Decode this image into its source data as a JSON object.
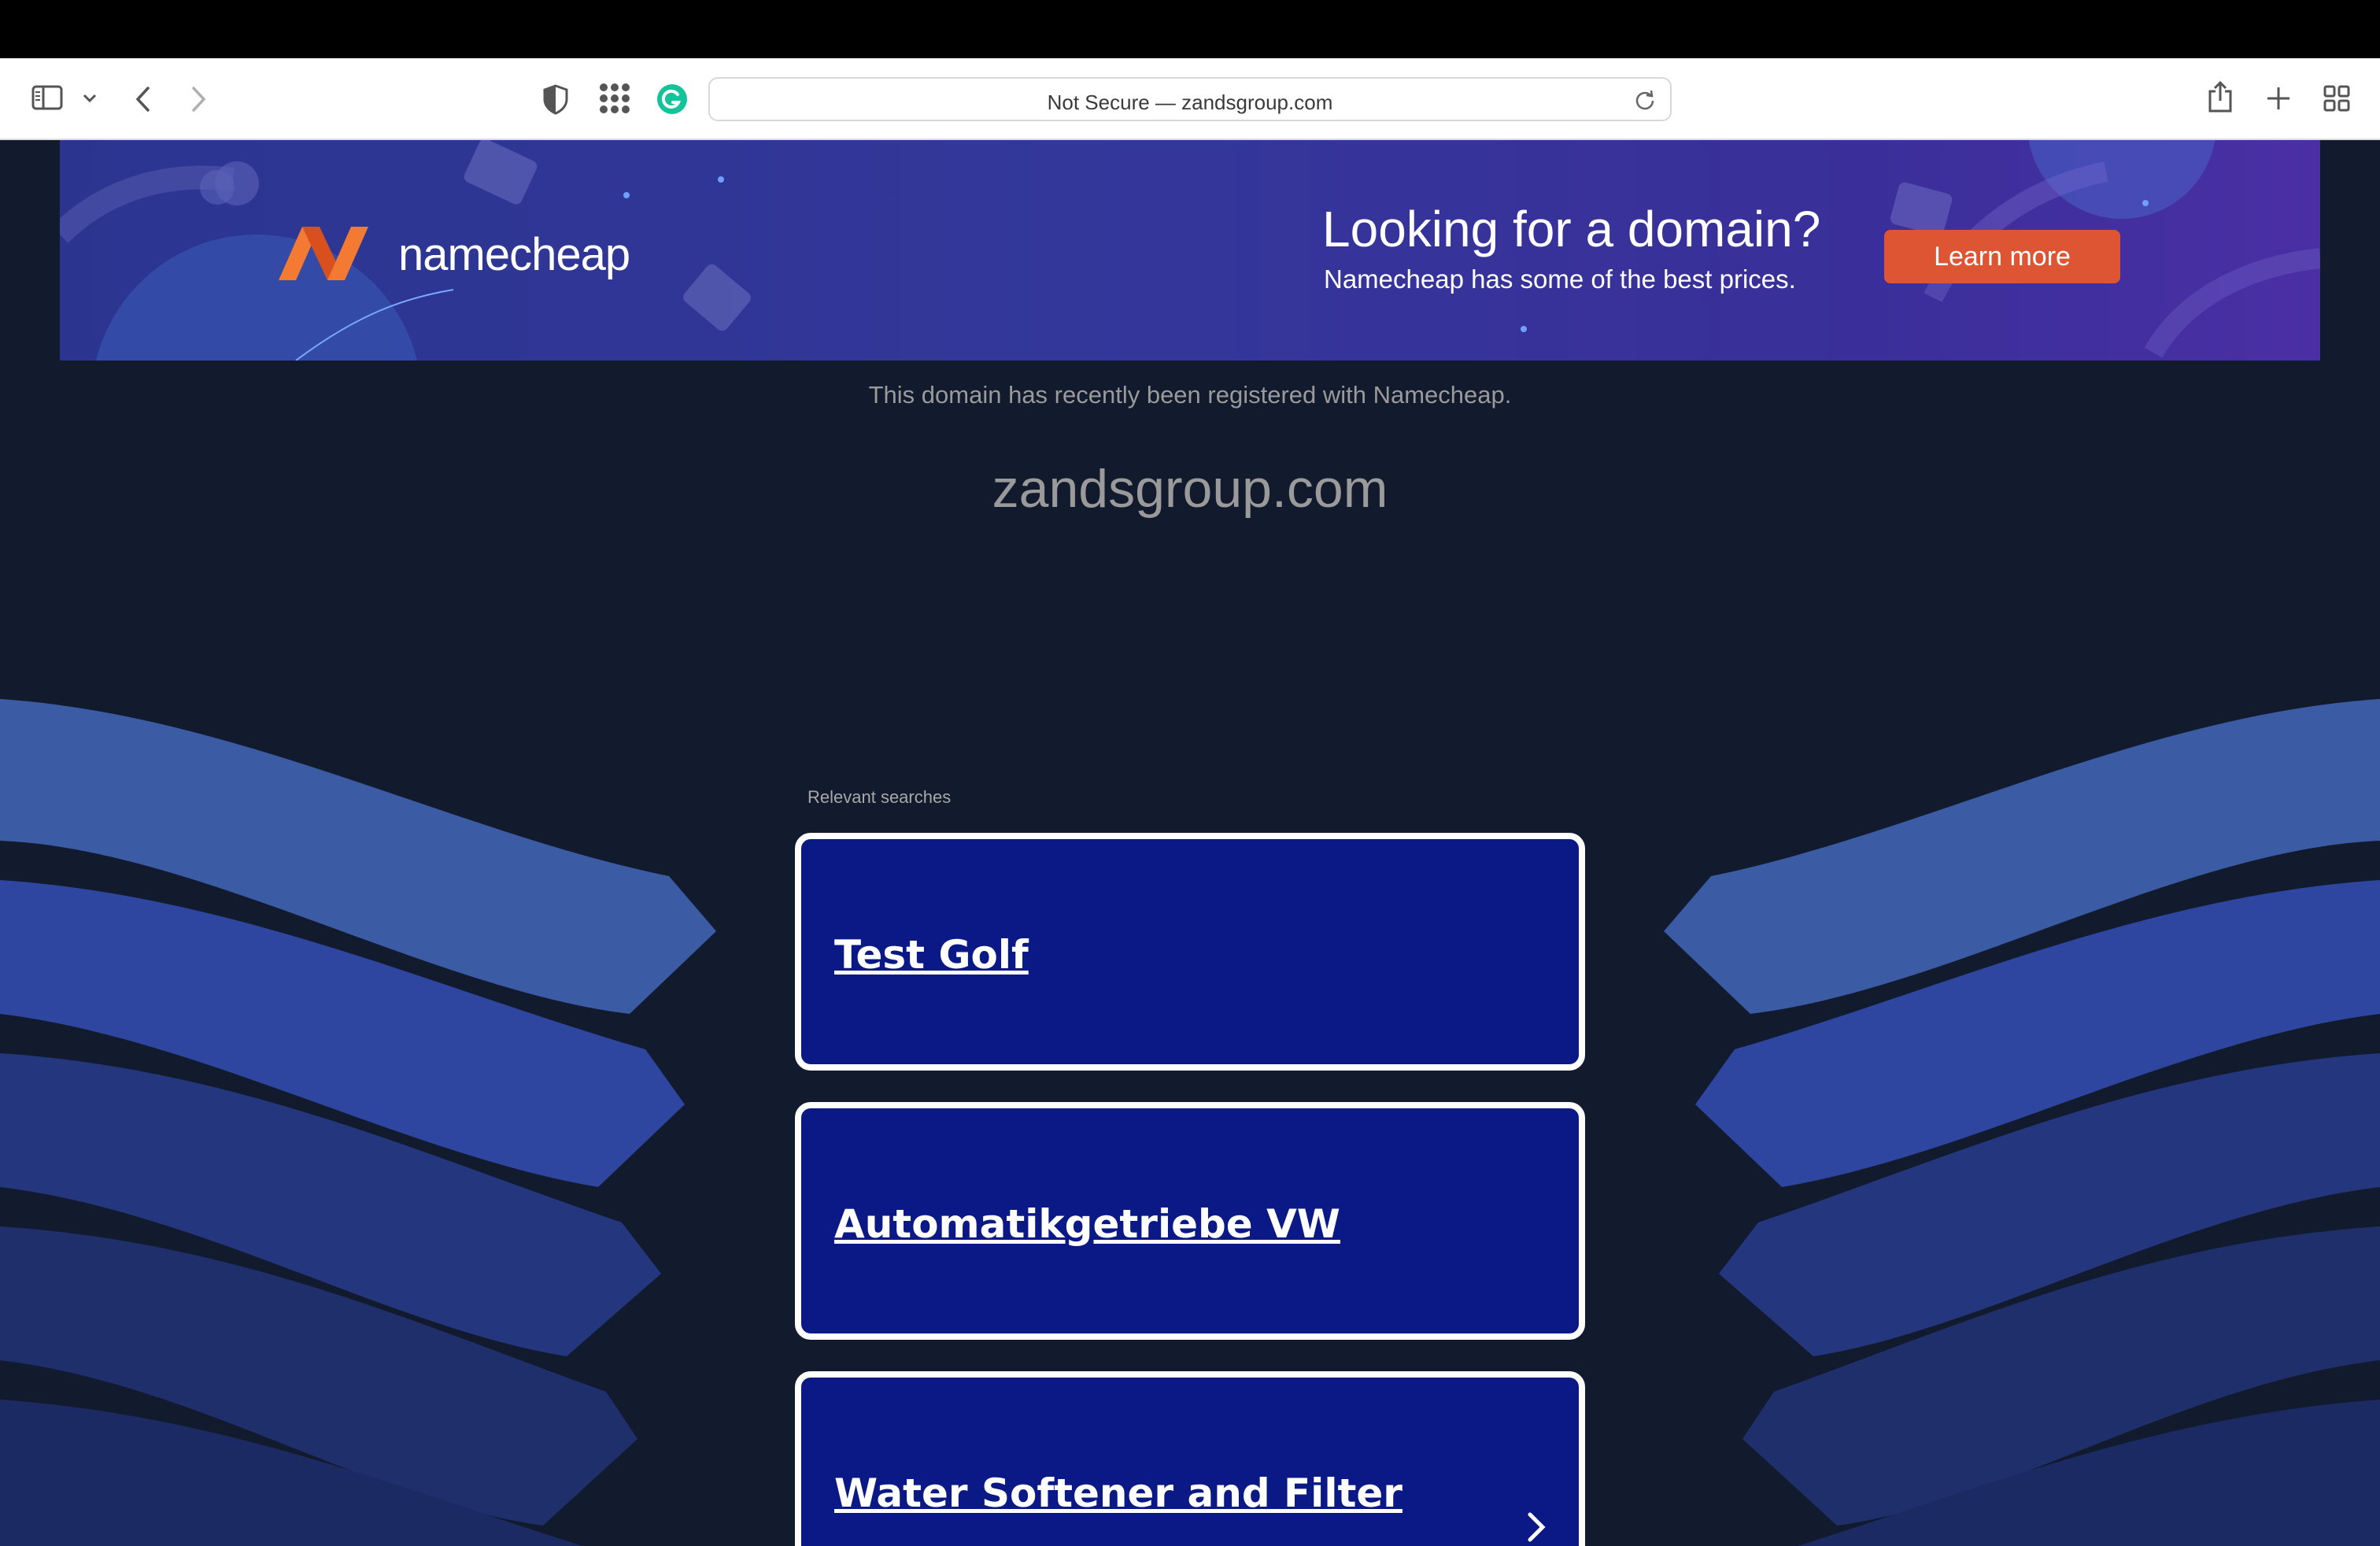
{
  "browser": {
    "address_text": "Not Secure — zandsgroup.com"
  },
  "icons": {
    "sidebar": "sidebar-icon",
    "tab_group_chevron": "chevron-down-icon",
    "back": "back-arrow-icon",
    "forward": "forward-arrow-icon",
    "privacy": "shield-icon",
    "extensions": "grid-dots-icon",
    "grammarly": "grammarly-icon",
    "reload": "reload-icon",
    "share": "share-icon",
    "new_tab": "plus-icon",
    "tab_overview": "tab-overview-icon",
    "card_more": "chevron-right-icon"
  },
  "banner": {
    "brand": "namecheap",
    "headline": "Looking for a domain?",
    "subtext": "Namecheap has some of the best prices.",
    "cta": "Learn more"
  },
  "page": {
    "registered_note": "This domain has recently been registered with Namecheap.",
    "domain": "zandsgroup.com",
    "relevant_label": "Relevant searches"
  },
  "searches": [
    "Test Golf",
    "Automatikgetriebe VW",
    "Water Softener and Filter"
  ],
  "colors": {
    "page_bg": "#121a2d",
    "card_bg": "#0a1985",
    "cta": "#de5533",
    "logo_orange": "#ee6a2c"
  }
}
